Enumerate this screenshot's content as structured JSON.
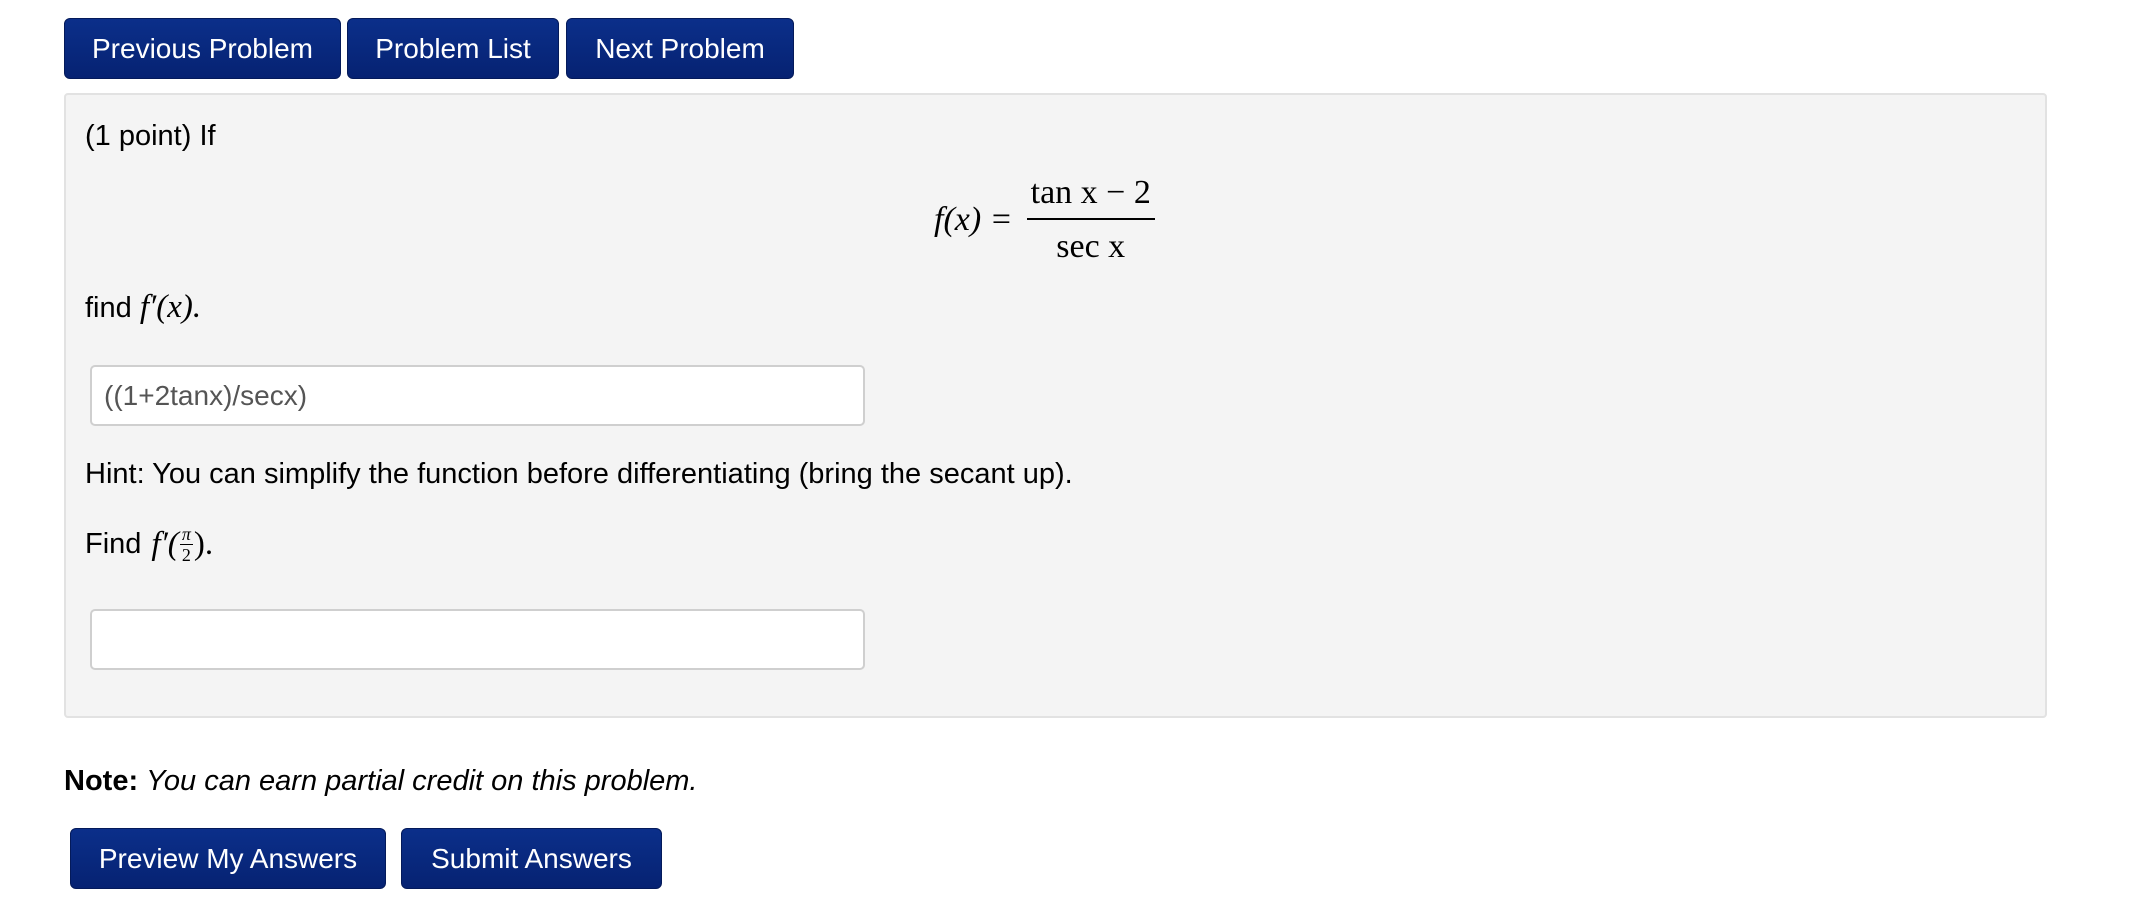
{
  "nav": {
    "previous_label": "Previous Problem",
    "list_label": "Problem List",
    "next_label": "Next Problem"
  },
  "problem": {
    "intro": "(1 point) If",
    "equation": {
      "lhs": "f(x) =",
      "numerator": "tan x − 2",
      "denominator": "sec x"
    },
    "part1_prefix": "find",
    "part1_math": "f′(x)",
    "part1_suffix": ".",
    "answer1_value": "((1+2tanx)/secx)",
    "hint": "Hint: You can simplify the function before differentiating (bring the secant up).",
    "part2_prefix": "Find",
    "part2_math_f": "f′(",
    "part2_frac_num": "π",
    "part2_frac_den": "2",
    "part2_math_close": ").",
    "answer2_value": ""
  },
  "note": {
    "label": "Note:",
    "text": "You can earn partial credit on this problem."
  },
  "actions": {
    "preview_label": "Preview My Answers",
    "submit_label": "Submit Answers"
  },
  "colors": {
    "button_bg": "#062272",
    "panel_bg": "#f4f4f4"
  }
}
